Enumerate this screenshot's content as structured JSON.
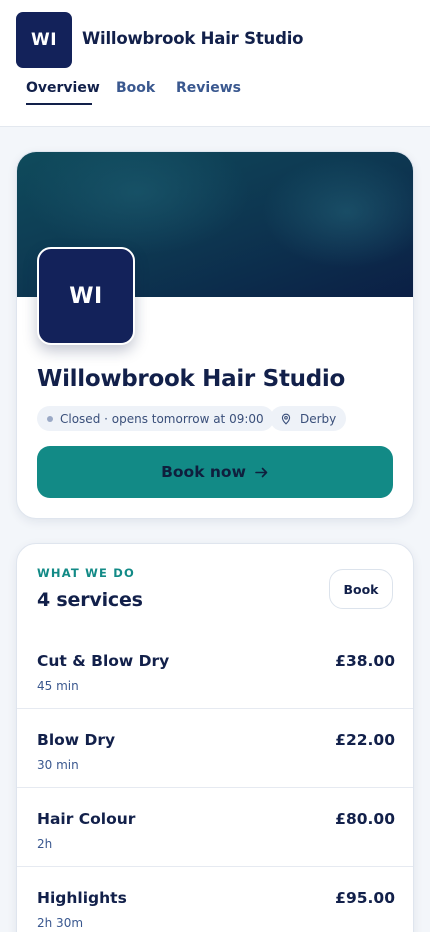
{
  "header": {
    "logo_initials": "WI",
    "title": "Willowbrook Hair Studio"
  },
  "tabs": [
    {
      "label": "Overview",
      "active": true
    },
    {
      "label": "Book",
      "active": false
    },
    {
      "label": "Reviews",
      "active": false
    }
  ],
  "hero": {
    "logo_initials": "WI",
    "name": "Willowbrook Hair Studio",
    "status": "Closed · opens tomorrow at 09:00",
    "location": "Derby",
    "location_icon": "map-pin-icon",
    "book_now_label": "Book now",
    "book_now_icon": "arrow-right-icon"
  },
  "services": {
    "eyebrow": "WHAT WE DO",
    "count_label": "4 services",
    "book_label": "Book",
    "items": [
      {
        "name": "Cut & Blow Dry",
        "duration": "45 min",
        "price": "£38.00"
      },
      {
        "name": "Blow Dry",
        "duration": "30 min",
        "price": "£22.00"
      },
      {
        "name": "Hair Colour",
        "duration": "2h",
        "price": "£80.00"
      },
      {
        "name": "Highlights",
        "duration": "2h 30m",
        "price": "£95.00"
      }
    ]
  },
  "colors": {
    "navy": "#13225a",
    "teal": "#128a86",
    "background": "#f3f6fa"
  }
}
